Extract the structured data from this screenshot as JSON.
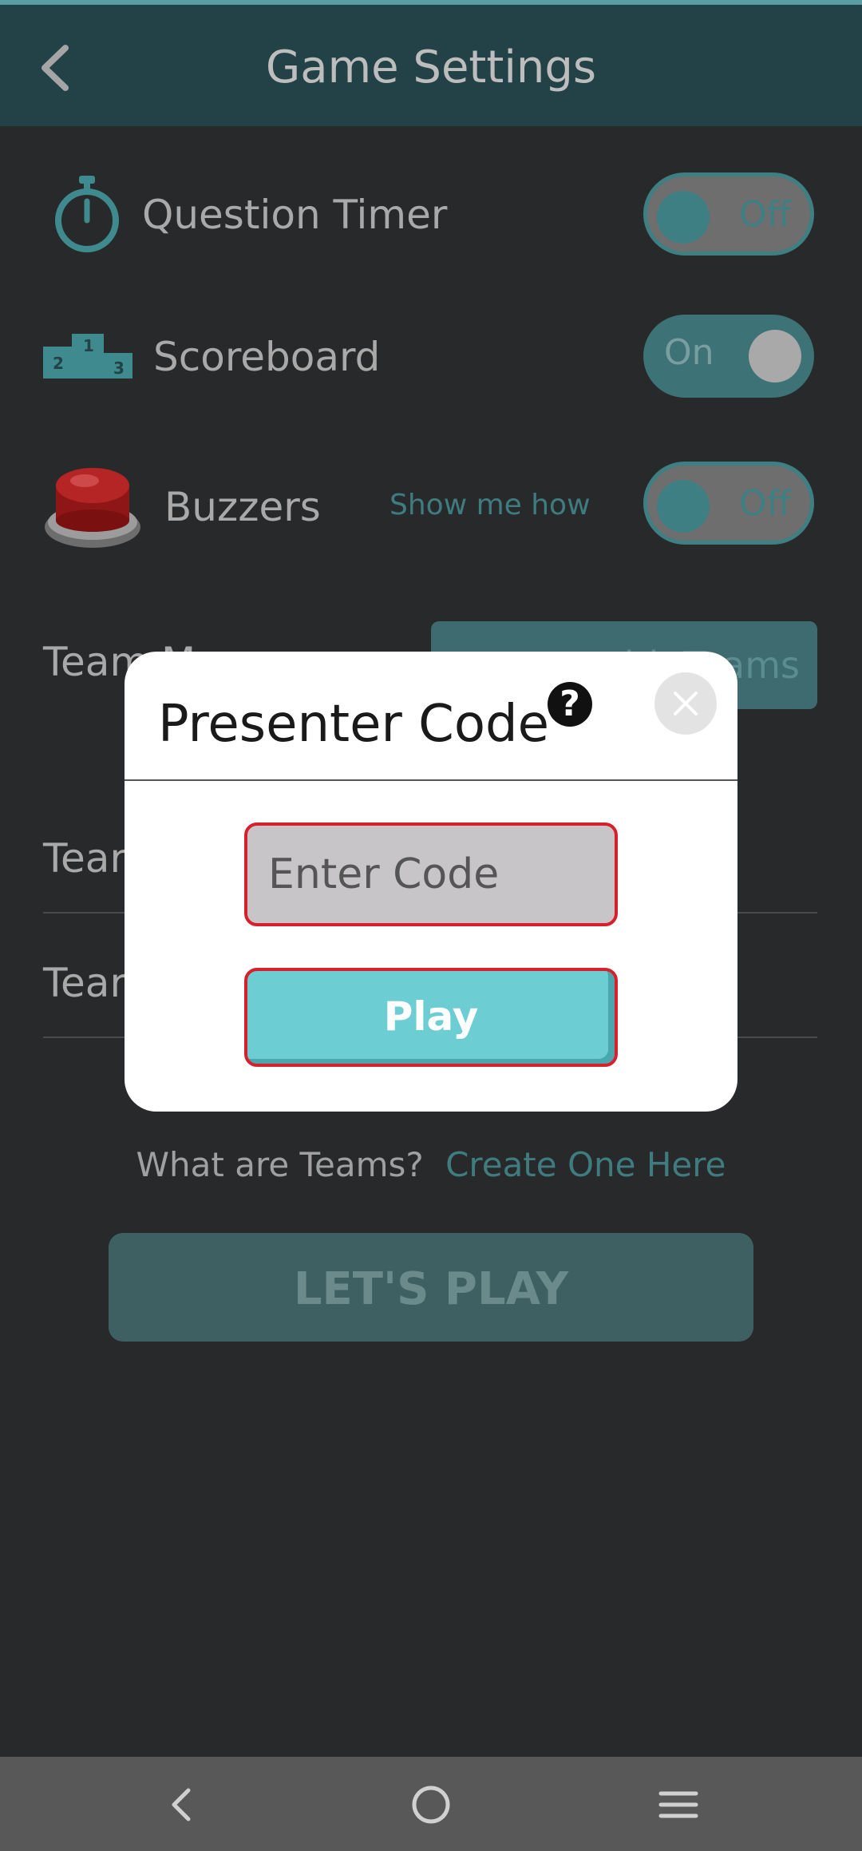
{
  "header": {
    "title": "Game Settings"
  },
  "settings": {
    "question_timer": {
      "label": "Question Timer",
      "toggle": "Off"
    },
    "scoreboard": {
      "label": "Scoreboard",
      "toggle": "On"
    },
    "buzzers": {
      "label": "Buzzers",
      "help_link": "Show me how",
      "toggle": "Off"
    },
    "teams": {
      "mode_label": "Team M",
      "button_label": "ith Teams",
      "row1_label": "Tear",
      "row2_label": "Tear"
    }
  },
  "teams_help": {
    "question": "What are Teams?",
    "link": "Create One Here"
  },
  "primary_button": "LET'S PLAY",
  "modal": {
    "title": "Presenter Code",
    "help_icon": "?",
    "code_placeholder": "Enter Code",
    "play_label": "Play"
  },
  "colors": {
    "accent": "#6ccdd3",
    "error_border": "#d8202b",
    "header": "#234248",
    "background": "#28292b"
  },
  "icons": [
    "back-arrow-icon",
    "stopwatch-icon",
    "podium-icon",
    "buzzer-icon",
    "help-icon",
    "close-icon",
    "nav-back-icon",
    "nav-home-icon",
    "nav-menu-icon"
  ]
}
